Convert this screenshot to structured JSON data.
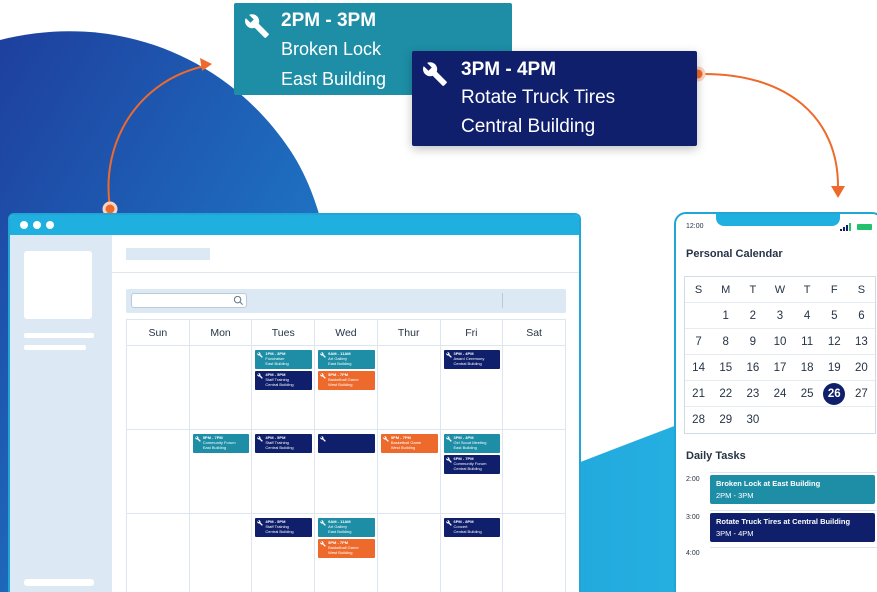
{
  "colors": {
    "teal": "#1d8ea6",
    "navy": "#0f1f6b",
    "orange": "#ee6a2c",
    "window_blue": "#1fb0e0",
    "sidebar": "#dce9f4",
    "background_wave": "#1f62b8"
  },
  "popups": [
    {
      "time": "2PM - 3PM",
      "title": "Broken Lock",
      "location": "East Building",
      "icon": "wrench-icon"
    },
    {
      "time": "3PM - 4PM",
      "title": "Rotate Truck Tires",
      "location": "Central Building",
      "icon": "wrench-icon"
    }
  ],
  "desktop": {
    "search": {
      "placeholder": "",
      "icon": "search-icon"
    },
    "weekdays": [
      "Sun",
      "Mon",
      "Tues",
      "Wed",
      "Thur",
      "Fri",
      "Sat"
    ],
    "weeks": [
      [
        [],
        [],
        [
          {
            "time": "1PM - 3PM",
            "title": "Fundraiser",
            "location": "East Building",
            "color": "teal"
          },
          {
            "time": "4PM - 5PM",
            "title": "Staff Training",
            "location": "Central Building",
            "color": "navy"
          }
        ],
        [
          {
            "time": "9AM - 11AM",
            "title": "Art Gallery",
            "location": "East Building",
            "color": "teal"
          },
          {
            "time": "5PM - 7PM",
            "title": "Basketball Game",
            "location": "West Building",
            "color": "orange"
          }
        ],
        [],
        [
          {
            "time": "3PM - 4PM",
            "title": "Award Ceremony",
            "location": "Central Building",
            "color": "navy"
          }
        ],
        []
      ],
      [
        [],
        [
          {
            "time": "5PM - 7PM",
            "title": "Community Forum",
            "location": "East Building",
            "color": "teal"
          }
        ],
        [
          {
            "time": "4PM - 5PM",
            "title": "Staff Training",
            "location": "Central Building",
            "color": "navy"
          }
        ],
        [
          {
            "time": "",
            "title": "",
            "location": "",
            "color": "navy"
          }
        ],
        [
          {
            "time": "5PM - 7PM",
            "title": "Basketball Game",
            "location": "West Building",
            "color": "orange"
          }
        ],
        [
          {
            "time": "3PM - 4PM",
            "title": "Girl Scout Meeting",
            "location": "East Building",
            "color": "teal"
          },
          {
            "time": "6PM - 7PM",
            "title": "Community Forum",
            "location": "Central Building",
            "color": "navy"
          }
        ],
        []
      ],
      [
        [],
        [],
        [
          {
            "time": "4PM - 5PM",
            "title": "Staff Training",
            "location": "Central Building",
            "color": "navy"
          }
        ],
        [
          {
            "time": "9AM - 11AM",
            "title": "Art Gallery",
            "location": "East Building",
            "color": "teal"
          },
          {
            "time": "5PM - 7PM",
            "title": "Basketball Game",
            "location": "West Building",
            "color": "orange"
          }
        ],
        [],
        [
          {
            "time": "6PM - 8PM",
            "title": "Concert",
            "location": "Central Building",
            "color": "navy"
          }
        ],
        []
      ]
    ]
  },
  "phone": {
    "status_time": "12:00",
    "title": "Personal Calendar",
    "weekday_initials": [
      "S",
      "M",
      "T",
      "W",
      "T",
      "F",
      "S"
    ],
    "month_rows": [
      [
        "",
        "1",
        "2",
        "3",
        "4",
        "5",
        "6"
      ],
      [
        "7",
        "8",
        "9",
        "10",
        "11",
        "12",
        "13"
      ],
      [
        "14",
        "15",
        "16",
        "17",
        "18",
        "19",
        "20"
      ],
      [
        "21",
        "22",
        "23",
        "24",
        "25",
        "26",
        "27"
      ],
      [
        "28",
        "29",
        "30",
        "",
        "",
        "",
        ""
      ]
    ],
    "selected_day": "26",
    "daily_tasks_title": "Daily Tasks",
    "time_slots": [
      "2:00",
      "3:00",
      "4:00"
    ],
    "tasks": [
      {
        "title": "Broken Lock at East Building",
        "time": "2PM - 3PM",
        "color": "teal"
      },
      {
        "title": "Rotate Truck Tires at Central Building",
        "time": "3PM - 4PM",
        "color": "navy"
      }
    ]
  }
}
